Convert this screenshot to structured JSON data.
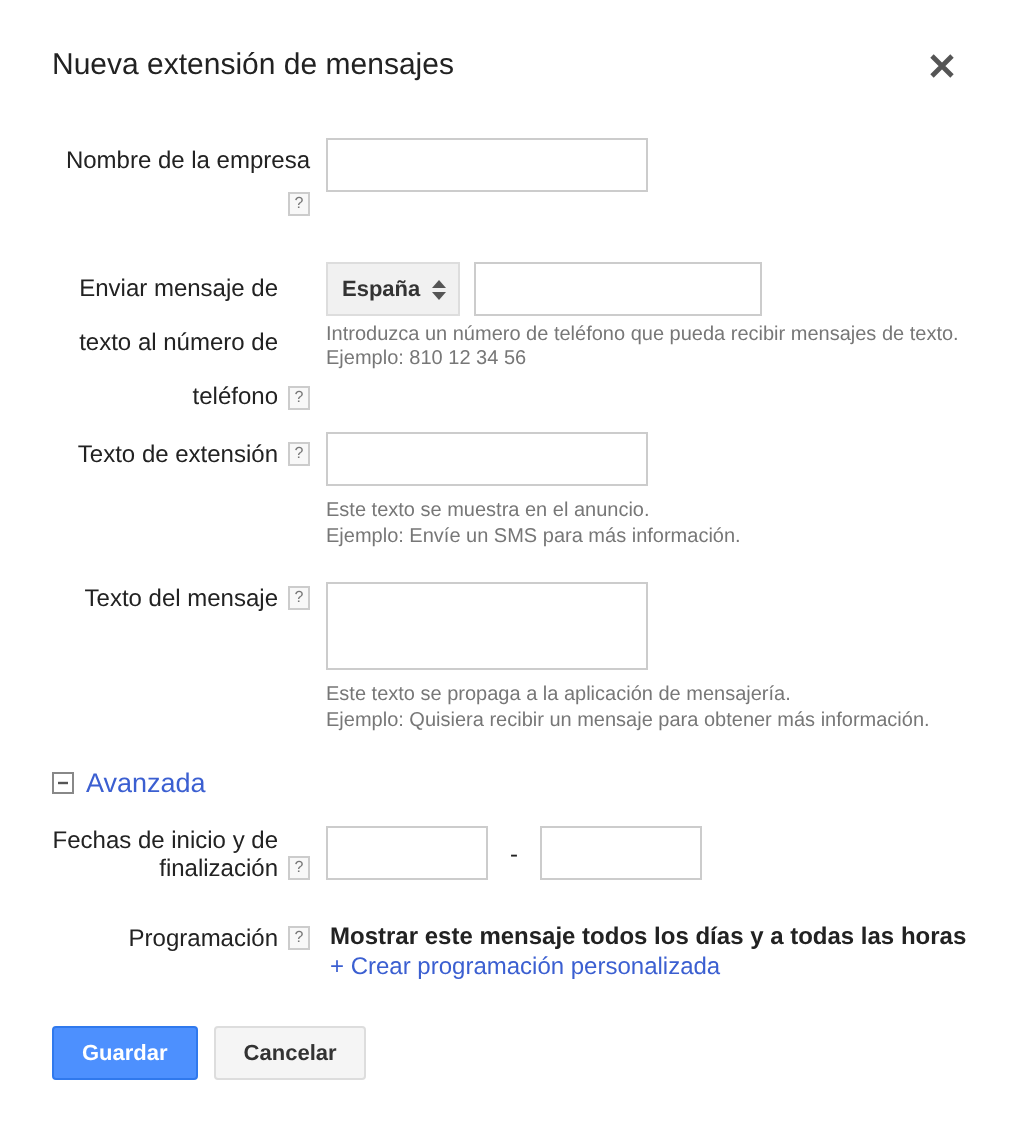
{
  "dialog": {
    "title": "Nueva extensión de mensajes"
  },
  "fields": [
    {
      "kind": "text",
      "label": "Nombre de la empresa",
      "help": "?"
    },
    {
      "kind": "phone",
      "label": "Enviar mensaje de texto al número de teléfono",
      "help": "?",
      "country": "España",
      "hints": [
        "Introduzca un número de teléfono que pueda recibir mensajes de texto.",
        "Ejemplo: 810 12 34 56"
      ]
    },
    {
      "kind": "text",
      "label": "Texto de extensión",
      "help": "?",
      "hints": [
        "Este texto se muestra en el anuncio.",
        "Ejemplo: Envíe un SMS para más información."
      ]
    },
    {
      "kind": "textarea",
      "label": "Texto del mensaje",
      "help": "?",
      "hints": [
        "Este texto se propaga a la aplicación de mensajería.",
        "Ejemplo: Quisiera recibir un mensaje para obtener más información."
      ]
    }
  ],
  "advanced": {
    "label": "Avanzada",
    "expanded": true,
    "fields": [
      {
        "kind": "daterange",
        "label": "Fechas de inicio y de finalización",
        "help": "?",
        "separator": "-"
      },
      {
        "kind": "schedule",
        "label": "Programación",
        "help": "?",
        "value": "Mostrar este mensaje todos los días y a todas las horas",
        "link": "+ Crear programación personalizada"
      }
    ]
  },
  "buttons": [
    {
      "kind": "primary",
      "label": "Guardar"
    },
    {
      "kind": "secondary",
      "label": "Cancelar"
    }
  ]
}
